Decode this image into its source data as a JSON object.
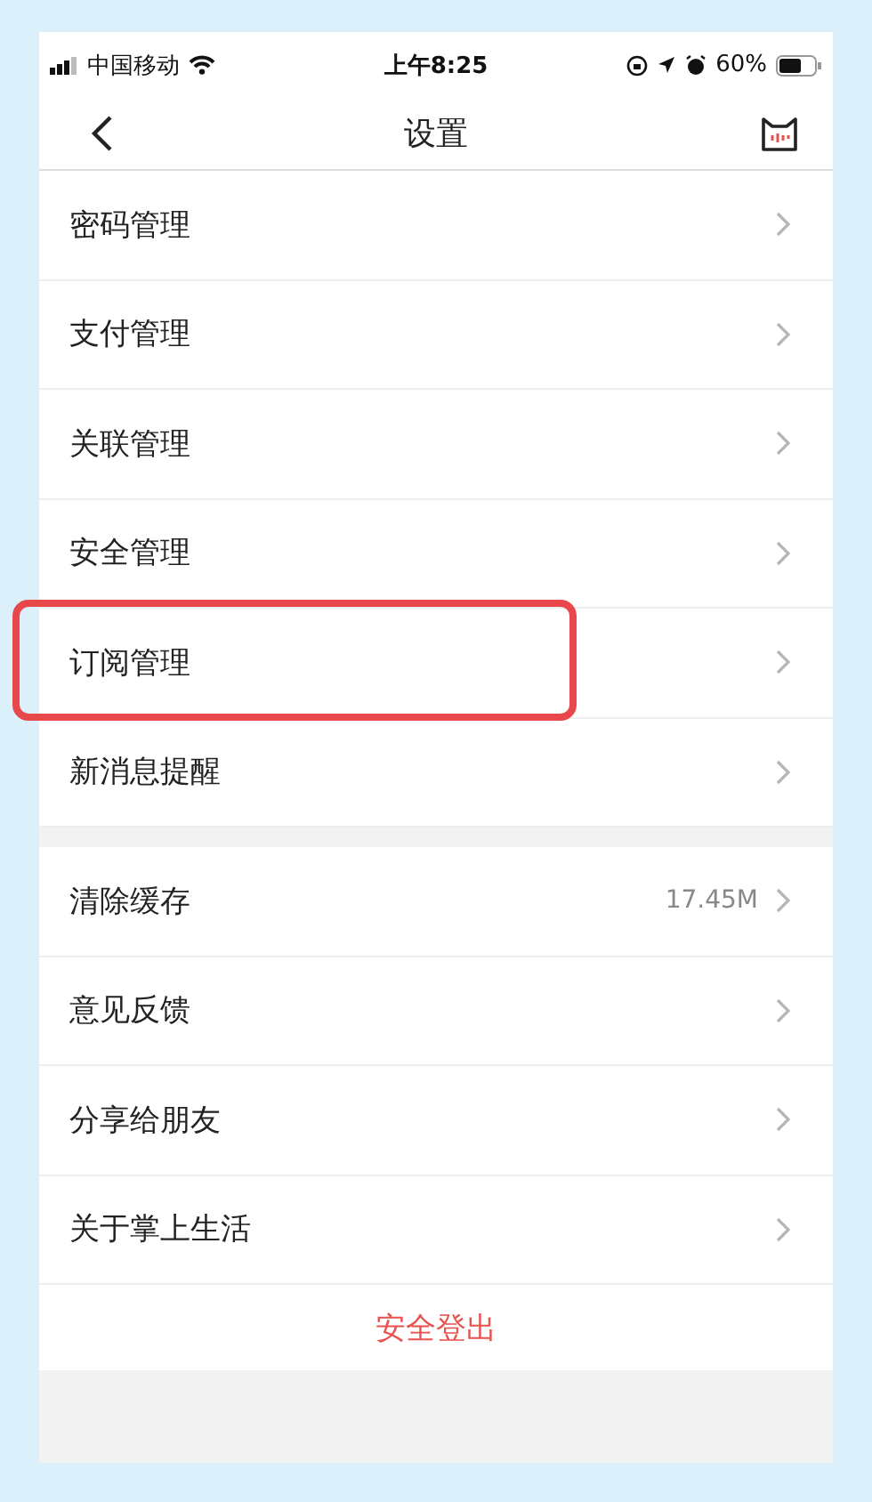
{
  "status_bar": {
    "carrier": "中国移动",
    "time": "上午8:25",
    "battery": "60%"
  },
  "nav": {
    "title": "设置"
  },
  "groups": [
    {
      "items": [
        {
          "label": "密码管理",
          "highlighted": false
        },
        {
          "label": "支付管理",
          "highlighted": false
        },
        {
          "label": "关联管理",
          "highlighted": false
        },
        {
          "label": "安全管理",
          "highlighted": false
        },
        {
          "label": "订阅管理",
          "highlighted": true
        },
        {
          "label": "新消息提醒",
          "highlighted": false
        }
      ]
    },
    {
      "items": [
        {
          "label": "清除缓存",
          "value": "17.45M",
          "highlighted": false
        },
        {
          "label": "意见反馈",
          "highlighted": false
        },
        {
          "label": "分享给朋友",
          "highlighted": false
        },
        {
          "label": "关于掌上生活",
          "highlighted": false
        }
      ]
    }
  ],
  "logout": "安全登出"
}
